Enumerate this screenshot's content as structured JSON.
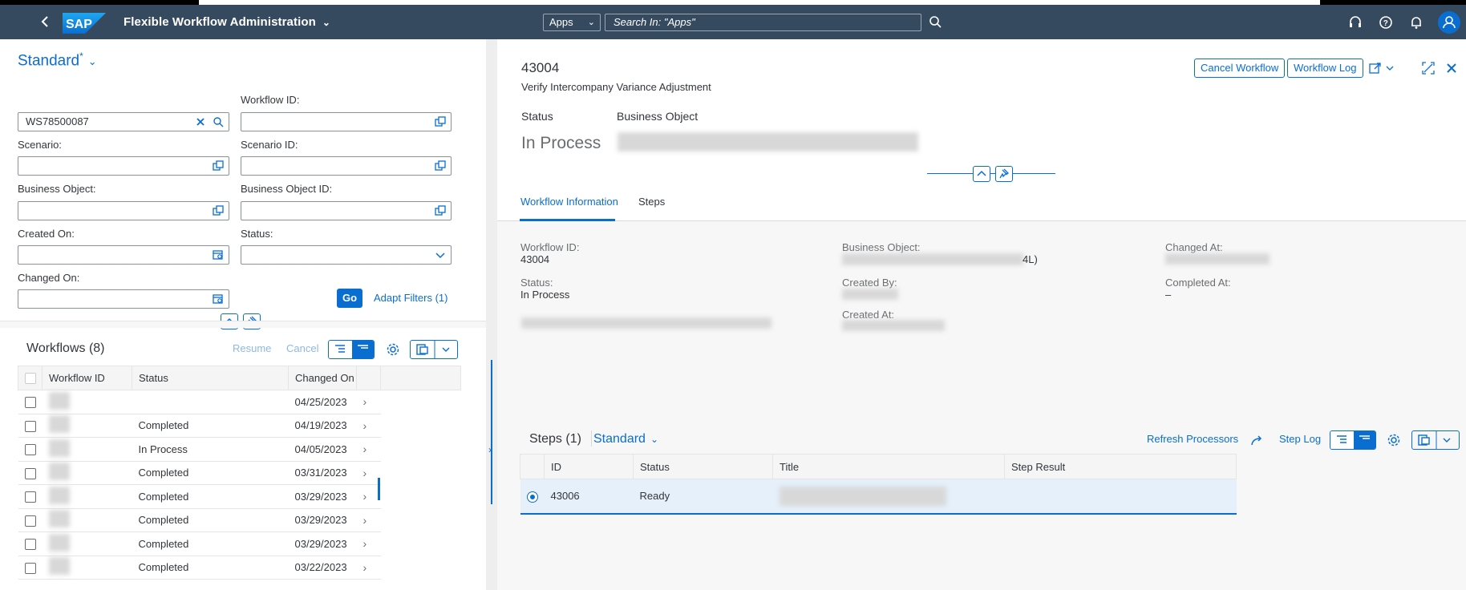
{
  "shell": {
    "title": "Flexible Workflow Administration",
    "scope": "Apps",
    "search_placeholder": "Search In: \"Apps\""
  },
  "filterbar": {
    "variant": "Standard",
    "variant_modified": "*",
    "search_value": "WS78500087",
    "workflow_id_label": "Workflow ID:",
    "scenario_label": "Scenario:",
    "scenario_id_label": "Scenario ID:",
    "business_object_label": "Business Object:",
    "business_object_id_label": "Business Object ID:",
    "created_on_label": "Created On:",
    "status_label": "Status:",
    "changed_on_label": "Changed On:",
    "go": "Go",
    "adapt_filters": "Adapt Filters (1)"
  },
  "workflows": {
    "title": "Workflows (8)",
    "resume": "Resume",
    "cancel": "Cancel",
    "columns": [
      "Workflow ID",
      "Status",
      "Changed On"
    ],
    "rows": [
      {
        "status": "",
        "changed_on": "04/25/2023"
      },
      {
        "status": "Completed",
        "changed_on": "04/19/2023"
      },
      {
        "status": "In Process",
        "changed_on": "04/05/2023"
      },
      {
        "status": "Completed",
        "changed_on": "03/31/2023"
      },
      {
        "status": "Completed",
        "changed_on": "03/29/2023"
      },
      {
        "status": "Completed",
        "changed_on": "03/29/2023"
      },
      {
        "status": "Completed",
        "changed_on": "03/29/2023"
      },
      {
        "status": "Completed",
        "changed_on": "03/22/2023"
      }
    ]
  },
  "detail": {
    "id": "43004",
    "subtitle": "Verify Intercompany Variance Adjustment",
    "cancel_workflow": "Cancel Workflow",
    "workflow_log": "Workflow Log",
    "status_label": "Status",
    "status_value": "In Process",
    "business_object_label": "Business Object",
    "tabs": [
      "Workflow Information",
      "Steps"
    ],
    "info": {
      "workflow_id_label": "Workflow ID:",
      "workflow_id_value": "43004",
      "status_label": "Status:",
      "status_value": "In Process",
      "business_object_label": "Business Object:",
      "business_object_value_tail": "4L)",
      "created_by_label": "Created By:",
      "created_at_label": "Created At:",
      "changed_at_label": "Changed At:",
      "completed_at_label": "Completed At:",
      "completed_at_value": "–"
    },
    "steps": {
      "title": "Steps (1)",
      "variant": "Standard",
      "refresh_processors": "Refresh Processors",
      "step_log": "Step Log",
      "columns": [
        "ID",
        "Status",
        "Title",
        "Step Result"
      ],
      "rows": [
        {
          "id": "43006",
          "status": "Ready",
          "title": "",
          "result": ""
        }
      ]
    }
  },
  "colors": {
    "shell": "#354a5f",
    "accent": "#0a6ed1"
  }
}
